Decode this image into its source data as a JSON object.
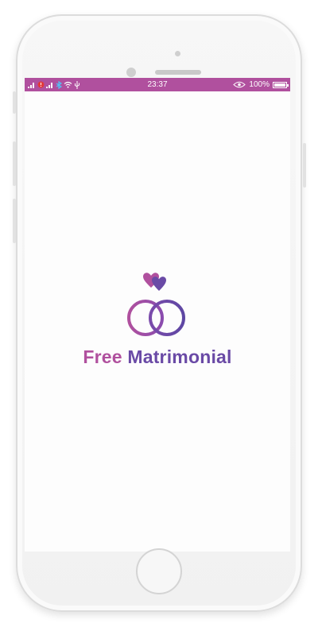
{
  "status_bar": {
    "time": "23:37",
    "battery_percent": "100%",
    "color": "#b0509e"
  },
  "app": {
    "brand_first": "Free",
    "brand_second": "Matrimonial",
    "brand_colors": {
      "pink": "#b0509e",
      "purple": "#6a4aa6"
    }
  },
  "icons": {
    "logo": "two-hearts-interlocked-rings-icon",
    "status_left": [
      "signal-icon",
      "sim-alert-icon",
      "signal-icon",
      "bluetooth-icon",
      "wifi-icon",
      "usb-icon"
    ],
    "status_right": [
      "eye-icon",
      "battery-icon"
    ]
  }
}
